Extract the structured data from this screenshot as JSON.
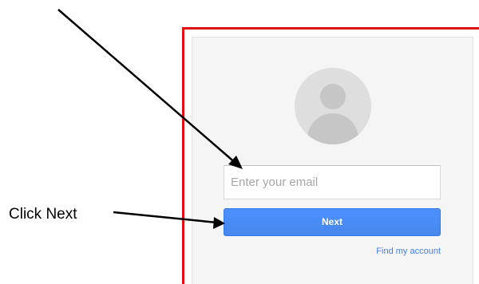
{
  "annotation": {
    "callout_label": "Click Next",
    "frame_color": "#e01010"
  },
  "signin": {
    "avatar_icon": "default-profile-avatar",
    "email_placeholder": "Enter your email",
    "email_value": "",
    "next_label": "Next",
    "find_account_label": "Find my account"
  },
  "colors": {
    "button_blue": "#4d90fe",
    "link_blue": "#427fed",
    "card_background": "#f5f5f5"
  }
}
